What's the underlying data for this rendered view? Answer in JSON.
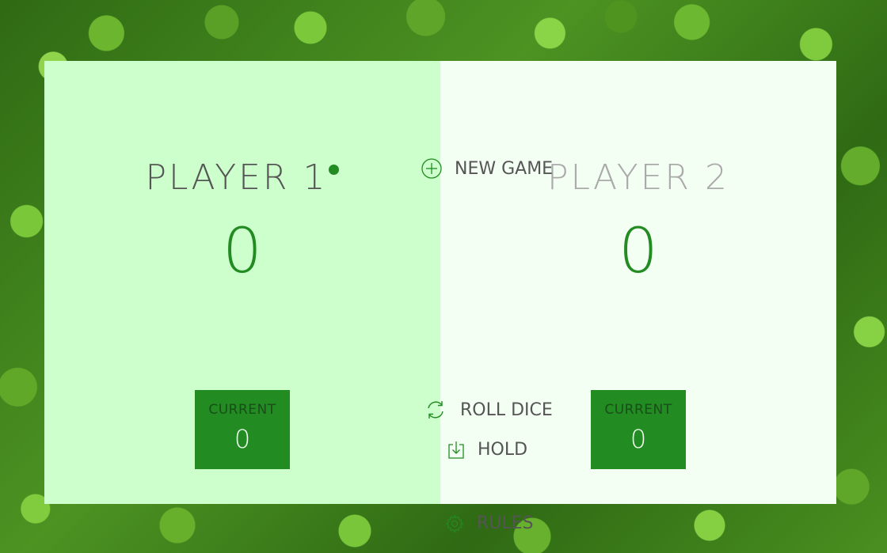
{
  "players": [
    {
      "name": "PLAYER 1",
      "score": "0",
      "current_label": "CURRENT",
      "current_score": "0",
      "active": true
    },
    {
      "name": "PLAYER 2",
      "score": "0",
      "current_label": "CURRENT",
      "current_score": "0",
      "active": false
    }
  ],
  "buttons": {
    "new_game": {
      "label": "NEW GAME",
      "icon": "plus-circle-icon"
    },
    "roll_dice": {
      "label": "ROLL DICE",
      "icon": "refresh-icon"
    },
    "hold": {
      "label": "HOLD",
      "icon": "download-icon"
    },
    "rules": {
      "label": "RULES",
      "icon": "gear-icon"
    }
  },
  "colors": {
    "accent": "#228b22",
    "active_panel": "#ccffcc",
    "inactive_panel": "#f4fff4",
    "text": "#555555"
  },
  "background": "clover-leaves-photo"
}
